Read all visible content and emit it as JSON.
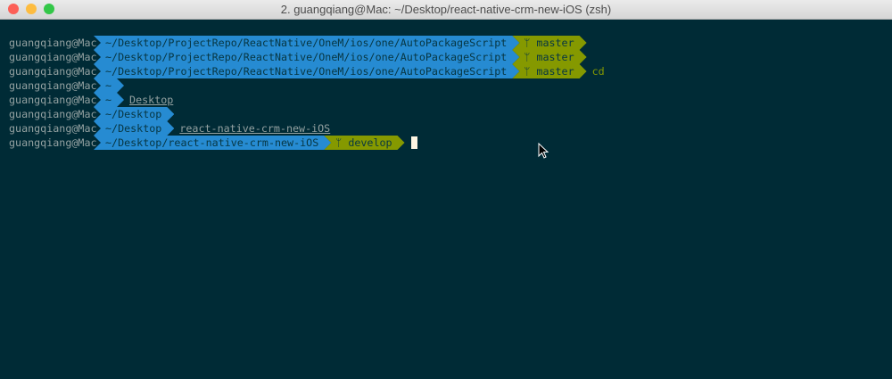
{
  "window": {
    "title": "2. guangqiang@Mac: ~/Desktop/react-native-crm-new-iOS (zsh)"
  },
  "colors": {
    "bg": "#002b36",
    "blue": "#268bd2",
    "green": "#859900"
  },
  "lines": [
    {
      "user": "guangqiang@Mac",
      "path": "~/Desktop/ProjectRepo/ReactNative/OneM/ios/one/AutoPackageScript",
      "branch": "master"
    },
    {
      "user": "guangqiang@Mac",
      "path": "~/Desktop/ProjectRepo/ReactNative/OneM/ios/one/AutoPackageScript",
      "branch": "master"
    },
    {
      "user": "guangqiang@Mac",
      "path": "~/Desktop/ProjectRepo/ReactNative/OneM/ios/one/AutoPackageScript",
      "branch": "master",
      "command": "cd"
    },
    {
      "user": "guangqiang@Mac",
      "path": "~"
    },
    {
      "user": "guangqiang@Mac",
      "path": "~",
      "suggestion": "Desktop"
    },
    {
      "user": "guangqiang@Mac",
      "path": "~/Desktop"
    },
    {
      "user": "guangqiang@Mac",
      "path": "~/Desktop",
      "suggestion": "react-native-crm-new-iOS"
    },
    {
      "user": "guangqiang@Mac",
      "path": "~/Desktop/react-native-crm-new-iOS",
      "branch": "develop"
    }
  ],
  "branch_icon": "ᛘ"
}
